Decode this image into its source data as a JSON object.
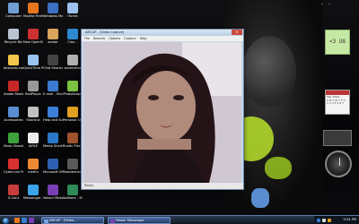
{
  "desktop_icons": [
    {
      "label": "Computer",
      "color": "#6f9fd6"
    },
    {
      "label": "Mozilla Firefox",
      "color": "#e8761c"
    },
    {
      "label": "Windows Movie...",
      "color": "#3b6fc2"
    },
    {
      "label": "iTunes",
      "color": "#9dc2ee"
    },
    {
      "label": "Recycle Bin",
      "color": "#b8c4d2"
    },
    {
      "label": "New OpenSnapt",
      "color": "#cc3030"
    },
    {
      "label": "avatar",
      "color": "#d9a45a"
    },
    {
      "label": "Clan...",
      "color": "#2e89cf"
    },
    {
      "label": "Jetstudio.com",
      "color": "#f2c64a"
    },
    {
      "label": "QuickTime Player",
      "color": "#9ac4f0"
    },
    {
      "label": "Chat Shortcut",
      "color": "#444"
    },
    {
      "label": "saverdrive",
      "color": "#b0b0b0"
    },
    {
      "label": "Adobe Reader 8",
      "color": "#c62828"
    },
    {
      "label": "RadPlayer",
      "color": "#999"
    },
    {
      "label": "E-mail - Shortcut",
      "color": "#3b7bd0"
    },
    {
      "label": "PhotoScape",
      "color": "#7cc142"
    },
    {
      "label": "Accessories",
      "color": "#5a8dd0"
    },
    {
      "label": "Shortcut",
      "color": "#c0c0c0"
    },
    {
      "label": "Help and Support",
      "color": "#3c7fd8"
    },
    {
      "label": "Personal Shortcut",
      "color": "#e0a020"
    },
    {
      "label": "Music Broadband",
      "color": "#3ca03c"
    },
    {
      "label": "AIRLE",
      "color": "#ececec"
    },
    {
      "label": "Media Shortcut",
      "color": "#2c78c8"
    },
    {
      "label": "Runtic Place Shortcut",
      "color": "#a0522d"
    },
    {
      "label": "CyberLink PowerDVD",
      "color": "#d93030"
    },
    {
      "label": "medi's",
      "color": "#ee8833"
    },
    {
      "label": "Microsoft Office Work...",
      "color": "#2f5fb0"
    },
    {
      "label": "Residential Evil Shortcut",
      "color": "#5a5a5a"
    },
    {
      "label": "X-Cent",
      "color": "#c83c3c"
    },
    {
      "label": "Messenger - Shortcut",
      "color": "#3ba3e8"
    },
    {
      "label": "Yahoo! Messenger",
      "color": "#7b3fb5"
    },
    {
      "label": "Solitaire - Shortcut",
      "color": "#2e8b57"
    }
  ],
  "cam_window": {
    "title": "AMCAP - [Video Capture]",
    "close_glyph": "✕",
    "menu": [
      "File",
      "Devices",
      "Options",
      "Capture",
      "Help"
    ],
    "status": "Ready"
  },
  "gadgets": {
    "note_text": "<3 U8",
    "calendar_lines": [
      "Mar 2009",
      "S M T W T F S",
      "1 2 3 4 5 6 7"
    ]
  },
  "taskbar": {
    "buttons": [
      {
        "label": "AMCAP - [Video...",
        "color": "#7aa5e0"
      },
      {
        "label": "Yahoo! Messenger",
        "color": "#7b3fb5"
      }
    ],
    "quicklaunch_colors": [
      "#e8761c",
      "#3b7bd0",
      "#7b3fb5"
    ],
    "clock": "9:24 PM"
  },
  "sidebar": {
    "nav_prev": "‹",
    "nav_next": "›"
  }
}
